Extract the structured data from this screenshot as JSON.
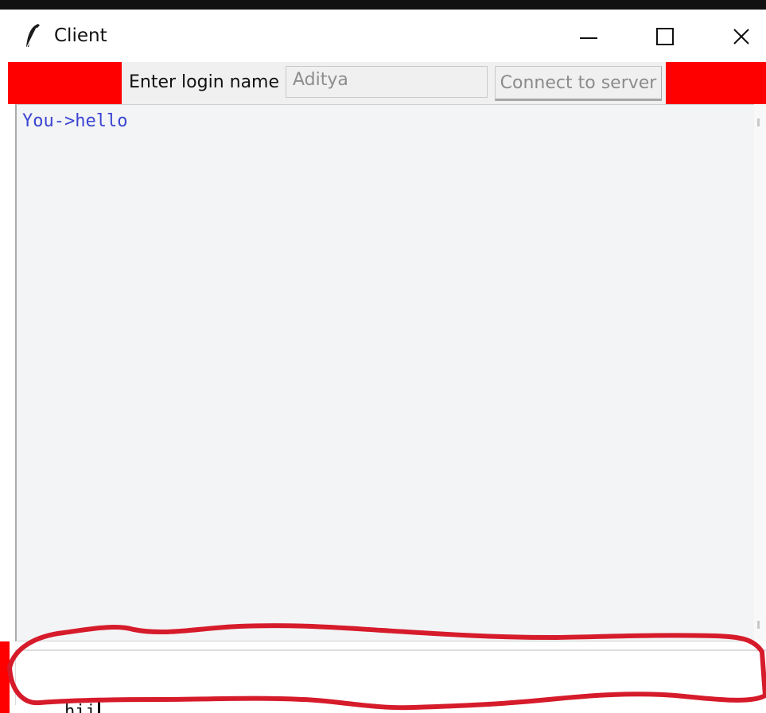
{
  "window": {
    "title": "Client",
    "icon": "feather-icon",
    "controls": {
      "minimize_icon": "minimize-icon",
      "maximize_icon": "maximize-icon",
      "close_icon": "close-icon"
    }
  },
  "login": {
    "label": "Enter login name",
    "name_value": "Aditya",
    "connect_label": "Connect to server"
  },
  "chat": {
    "messages": [
      "You->hello"
    ]
  },
  "entry": {
    "value": "hii"
  },
  "colors": {
    "header_background": "#ff0000",
    "chat_text": "#3a44d2",
    "annotation_outline": "#d61b2b"
  }
}
